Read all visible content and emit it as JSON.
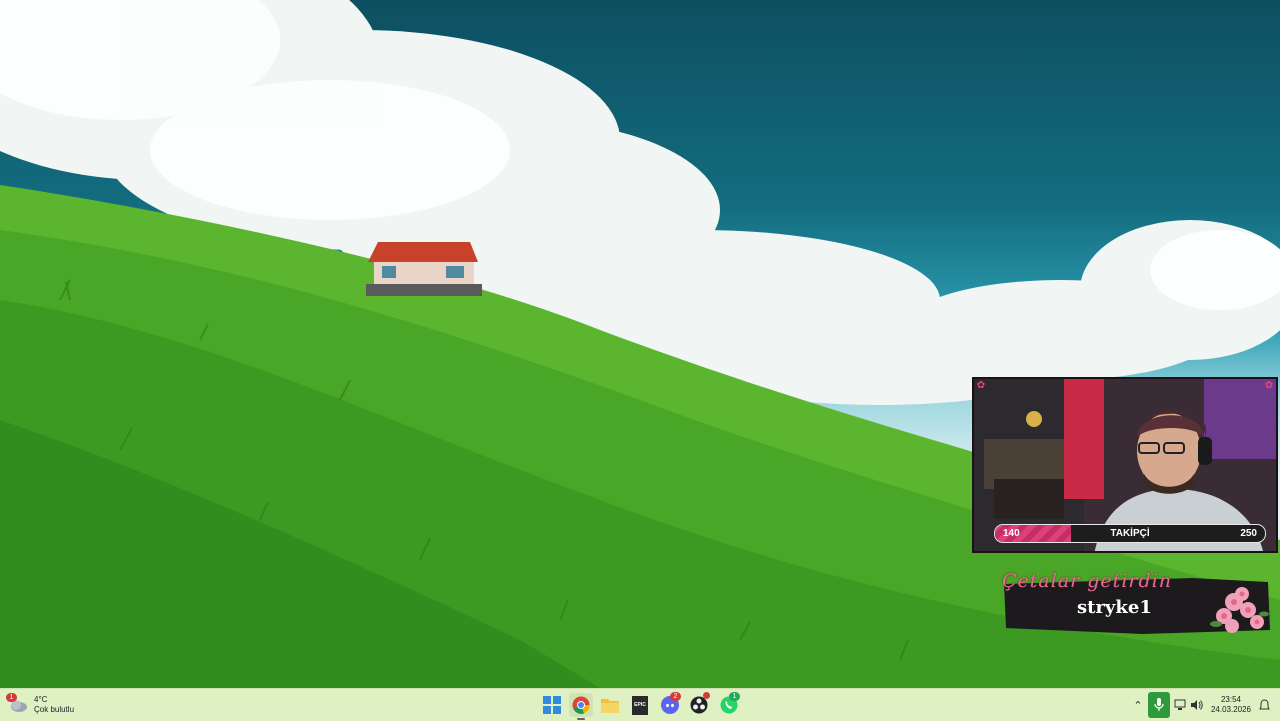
{
  "webcam": {
    "follower_bar": {
      "min_label": "140",
      "label": "TAKİPÇİ",
      "max_label": "250",
      "current": 140,
      "min": 140,
      "max": 250
    }
  },
  "alert": {
    "title": "Çetalar getirdin",
    "username": "stryke1"
  },
  "taskbar": {
    "weather": {
      "temperature": "4°C",
      "condition": "Çok bulutlu",
      "badge": "1"
    },
    "apps": [
      {
        "name": "start-button-icon"
      },
      {
        "name": "chrome-icon",
        "active": true
      },
      {
        "name": "file-explorer-icon"
      },
      {
        "name": "epic-games-icon",
        "label": "EPIC"
      },
      {
        "name": "discord-icon",
        "badge": "2"
      },
      {
        "name": "obs-icon"
      },
      {
        "name": "whatsapp-icon",
        "badge": "1"
      }
    ],
    "tray": {
      "time": "23:54",
      "date": "24.03.2026"
    }
  },
  "colors": {
    "taskbar_bg": "#dff0c2",
    "accent_pink": "#e0407a",
    "grass": "#5bb52e",
    "sky": "#136d7f"
  }
}
